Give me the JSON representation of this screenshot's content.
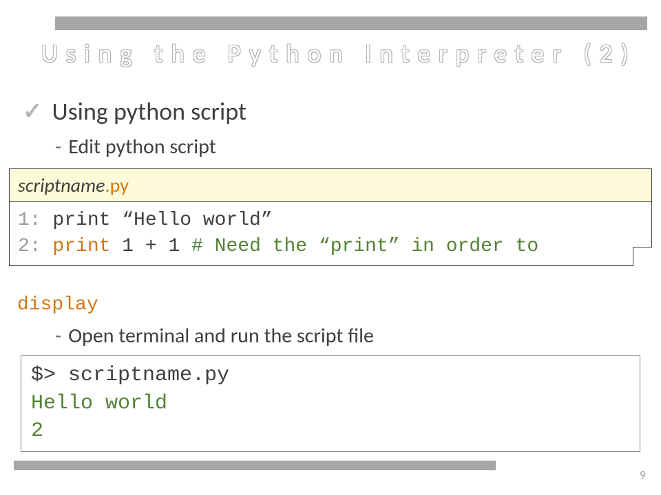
{
  "title": "Using the Python Interpreter (2)",
  "main_bullet": "Using python script",
  "sub_bullet_1": "Edit python script",
  "sub_bullet_2": "Open terminal and run the script file",
  "file": {
    "basename": "scriptname",
    "ext": ".py",
    "line1_num": "1:",
    "line1_code": " print “Hello world”",
    "line2_num": "2:",
    "line2_kw": " print",
    "line2_rest": " 1 + 1 ",
    "line2_comment": " # Need the “print” in order to",
    "overflow": "display"
  },
  "terminal": {
    "prompt": "$> scriptname.py",
    "out1": "Hello world",
    "out2": "2"
  },
  "page_number": "9"
}
